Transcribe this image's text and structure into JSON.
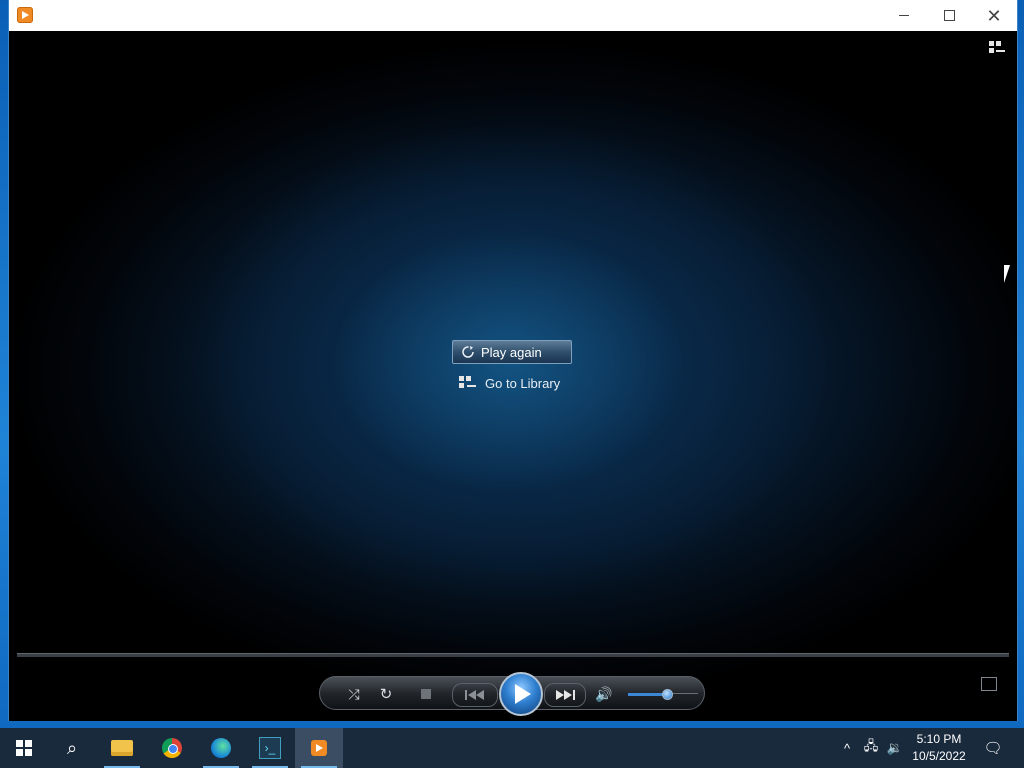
{
  "window": {
    "controls": {
      "minimize": "minimize",
      "maximize": "maximize",
      "close": "close"
    }
  },
  "overlay": {
    "play_again": "Play again",
    "go_to_library": "Go to Library"
  },
  "controls": {
    "volume_level": 0.55,
    "icons": [
      "shuffle-icon",
      "repeat-icon",
      "stop-icon",
      "previous-icon",
      "play-icon",
      "next-icon",
      "volume-icon"
    ]
  },
  "taskbar": {
    "apps": [
      "start",
      "search",
      "file-explorer",
      "chrome",
      "edge",
      "app",
      "windows-media-player"
    ],
    "time": "5:10 PM",
    "date": "10/5/2022"
  },
  "colors": {
    "accent": "#2f7fd0",
    "taskbar": "#1a2a3d"
  }
}
